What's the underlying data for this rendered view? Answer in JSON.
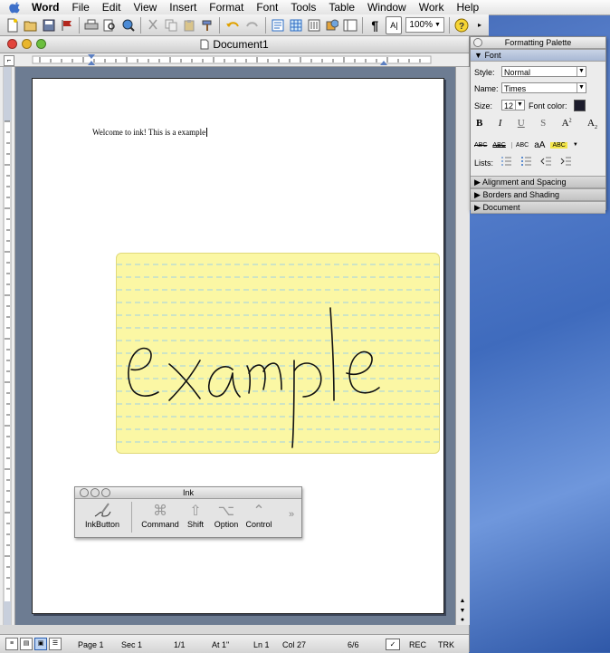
{
  "menubar": {
    "items": [
      "Word",
      "File",
      "Edit",
      "View",
      "Insert",
      "Format",
      "Font",
      "Tools",
      "Table",
      "Window",
      "Work",
      "Help"
    ]
  },
  "toolbar": {
    "zoom": "100%"
  },
  "window": {
    "title": "Document1"
  },
  "document": {
    "text": "Welcome to ink! This is a example",
    "ink_word": "example"
  },
  "palette": {
    "title": "Formatting Palette",
    "font_section": "Font",
    "style_label": "Style:",
    "style_value": "Normal",
    "name_label": "Name:",
    "name_value": "Times",
    "size_label": "Size:",
    "size_value": "12",
    "font_color_label": "Font color:",
    "lists_label": "Lists:",
    "sections": [
      "Alignment and Spacing",
      "Borders and Shading",
      "Document"
    ]
  },
  "ink_window": {
    "title": "Ink",
    "buttons": [
      "InkButton",
      "Command",
      "Shift",
      "Option",
      "Control"
    ]
  },
  "statusbar": {
    "page": "Page 1",
    "sec": "Sec 1",
    "pages": "1/1",
    "at": "At 1\"",
    "ln": "Ln 1",
    "col": "Col 27",
    "words": "6/6",
    "rec": "REC",
    "trk": "TRK"
  },
  "colors": {
    "desktop": "#3d67b4",
    "note": "#fbf7a4",
    "note_line": "#9fd0e6",
    "ink": "#111111"
  }
}
